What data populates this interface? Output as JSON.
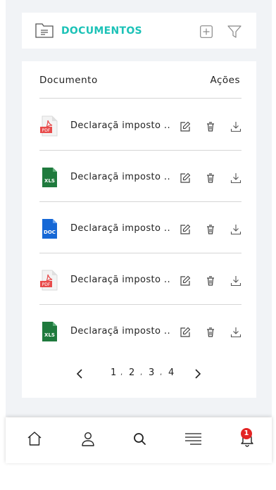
{
  "header": {
    "title": "DOCUMENTOS",
    "icons": [
      "folder-icon",
      "add-icon",
      "filter-icon"
    ]
  },
  "table": {
    "columns": [
      "Documento",
      "Ações"
    ],
    "rows": [
      {
        "type": "PDF",
        "icon": "pdf-file-icon",
        "name": "Declaraçã imposto .."
      },
      {
        "type": "XLS",
        "icon": "xls-file-icon",
        "name": "Declaraçã imposto .."
      },
      {
        "type": "DOC",
        "icon": "doc-file-icon",
        "name": "Declaraçã imposto .."
      },
      {
        "type": "PDF",
        "icon": "pdf-file-icon",
        "name": "Declaraçã imposto .."
      },
      {
        "type": "XLS",
        "icon": "xls-file-icon",
        "name": "Declaraçã imposto .."
      }
    ],
    "row_actions": [
      "edit-icon",
      "delete-icon",
      "download-icon"
    ]
  },
  "pagination": {
    "pages": [
      "1",
      "2",
      "3",
      "4"
    ],
    "separator": ","
  },
  "bottom_nav": {
    "items": [
      "home-icon",
      "user-icon",
      "search-icon",
      "menu-icon",
      "bell-icon"
    ],
    "notification_count": "1"
  },
  "colors": {
    "accent": "#1cc2b7",
    "pdf": "#e84b4b",
    "xls": "#1f7a3d",
    "doc": "#1668d6",
    "badge": "#e32424"
  }
}
